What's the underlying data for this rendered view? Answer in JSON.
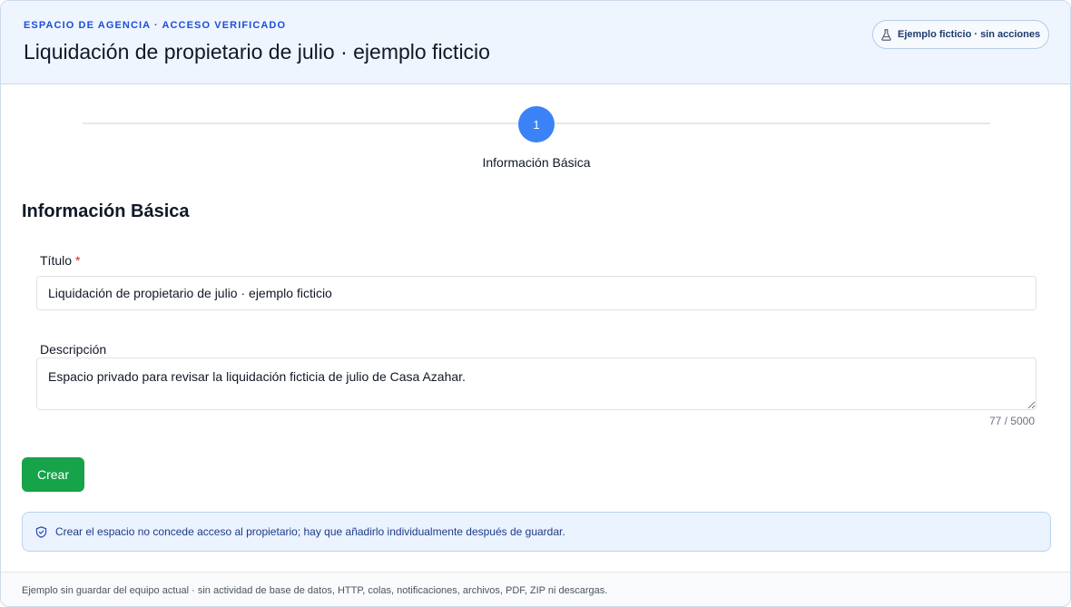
{
  "header": {
    "eyebrow": "ESPACIO DE AGENCIA · ACCESO VERIFICADO",
    "title": "Liquidación de propietario de julio · ejemplo ficticio",
    "badge": {
      "icon": "flask-icon",
      "label": "Ejemplo ficticio · sin acciones"
    }
  },
  "stepper": {
    "steps": [
      {
        "number": "1",
        "label": "Información Básica",
        "active": true
      }
    ],
    "active_color": "#3b82f6"
  },
  "form": {
    "section_title": "Información Básica",
    "title_field": {
      "label": "Título",
      "required_marker": "*",
      "value": "Liquidación de propietario de julio · ejemplo ficticio"
    },
    "description_field": {
      "label": "Descripción",
      "value": "Espacio privado para revisar la liquidación ficticia de julio de Casa Azahar.",
      "counter": "77 / 5000"
    },
    "submit_label": "Crear",
    "submit_color": "#16a34a"
  },
  "notice": {
    "icon": "shield-check-icon",
    "text": "Crear el espacio no concede acceso al propietario; hay que añadirlo individualmente después de guardar."
  },
  "footer": {
    "text": "Ejemplo sin guardar del equipo actual · sin actividad de base de datos, HTTP, colas, notificaciones, archivos, PDF, ZIP ni descargas."
  }
}
